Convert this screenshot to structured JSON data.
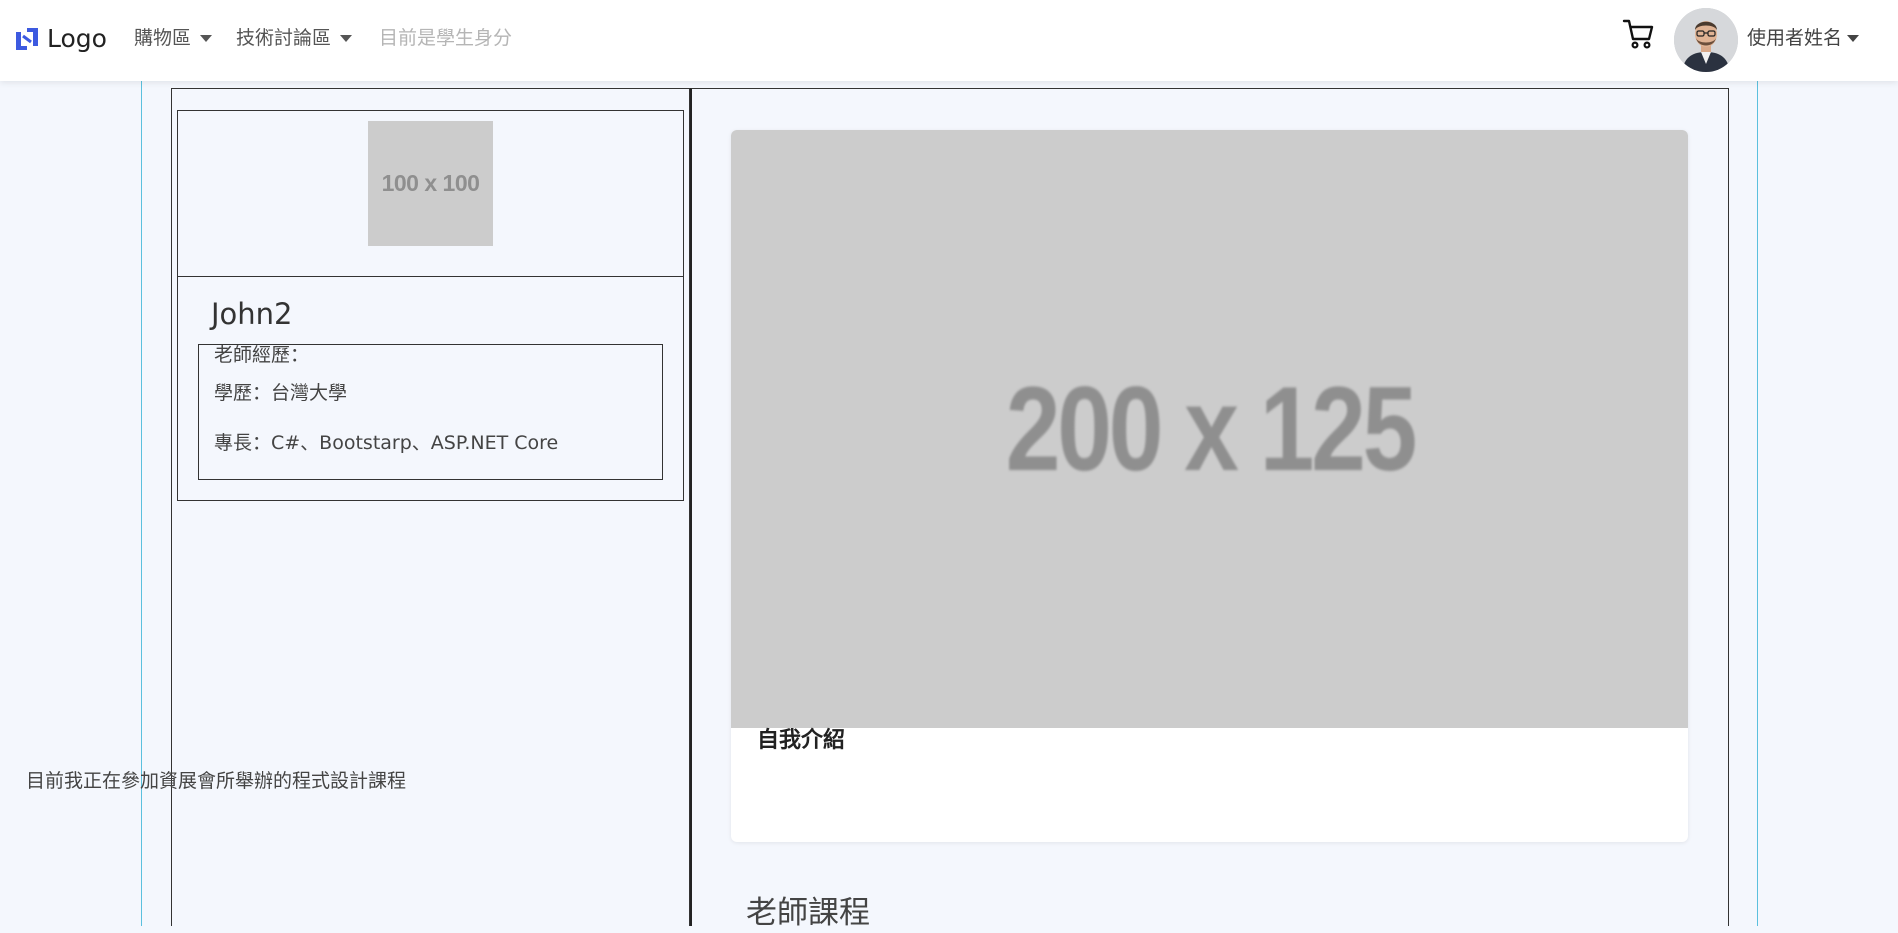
{
  "navbar": {
    "brand": "Logo",
    "menus": [
      {
        "label": "購物區"
      },
      {
        "label": "技術討論區"
      }
    ],
    "status": "目前是學生身分",
    "user_name": "使用者姓名"
  },
  "profile": {
    "photo_placeholder": "100 x 100",
    "name": "John2",
    "experience_label": "老師經歷：",
    "education": "學歷：台灣大學",
    "skills": "專長：C#、Bootstarp、ASP.NET Core"
  },
  "intro_card": {
    "image_placeholder": "200 x 125",
    "title": "自我介紹",
    "text": "目前我正在參加資展會所舉辦的程式設計課程"
  },
  "courses": {
    "title": "老師課程"
  },
  "colors": {
    "brand_blue": "#3d5ae0",
    "container_guide": "#5bc0de",
    "page_bg": "#f4f7fd",
    "placeholder": "#cccccc"
  }
}
